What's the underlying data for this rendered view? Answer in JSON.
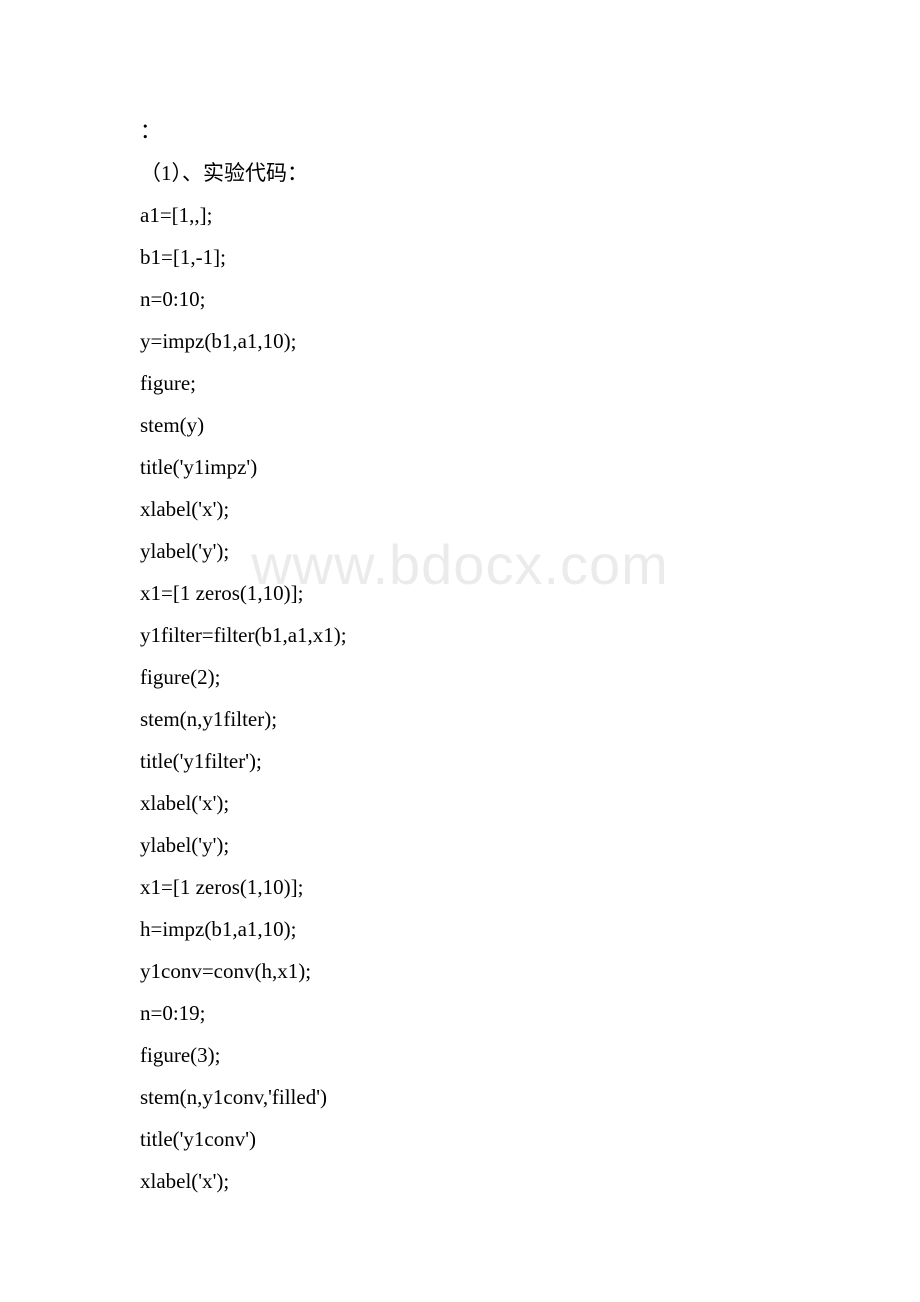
{
  "watermark": "www.bdocx.com",
  "lines": [
    "：",
    "（1）、实验代码：",
    "a1=[1,,];",
    "b1=[1,-1];",
    "n=0:10;",
    "y=impz(b1,a1,10);",
    "figure;",
    "stem(y)",
    "title('y1impz')",
    "xlabel('x');",
    "ylabel('y');",
    "x1=[1 zeros(1,10)];",
    "y1filter=filter(b1,a1,x1);",
    "figure(2);",
    "stem(n,y1filter);",
    "title('y1filter');",
    "xlabel('x');",
    "ylabel('y');",
    "x1=[1 zeros(1,10)];",
    "h=impz(b1,a1,10);",
    "y1conv=conv(h,x1);",
    "n=0:19;",
    "figure(3);",
    "stem(n,y1conv,'filled')",
    "title('y1conv')",
    "xlabel('x');"
  ]
}
